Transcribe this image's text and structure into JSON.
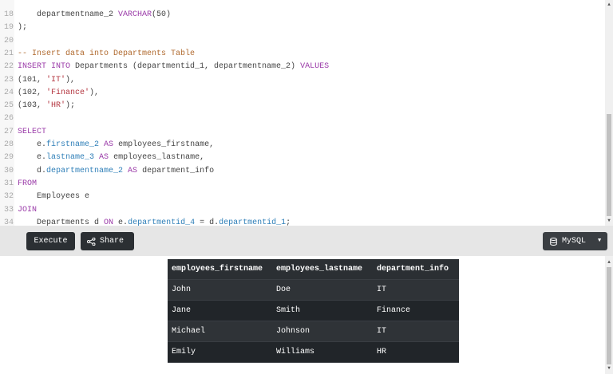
{
  "editor": {
    "lines": [
      {
        "n": "18",
        "tokens": [
          {
            "c": "tx",
            "t": "    departmentname_2 "
          },
          {
            "c": "kw",
            "t": "VARCHAR"
          },
          {
            "c": "tx",
            "t": "(50)"
          }
        ]
      },
      {
        "n": "19",
        "tokens": [
          {
            "c": "tx",
            "t": ");"
          }
        ]
      },
      {
        "n": "20",
        "tokens": []
      },
      {
        "n": "21",
        "tokens": [
          {
            "c": "cm",
            "t": "-- Insert data into Departments Table"
          }
        ]
      },
      {
        "n": "22",
        "tokens": [
          {
            "c": "kw",
            "t": "INSERT INTO"
          },
          {
            "c": "tx",
            "t": " Departments (departmentid_1, departmentname_2) "
          },
          {
            "c": "kw",
            "t": "VALUES"
          }
        ]
      },
      {
        "n": "23",
        "tokens": [
          {
            "c": "tx",
            "t": "(101, "
          },
          {
            "c": "str",
            "t": "'IT'"
          },
          {
            "c": "tx",
            "t": "),"
          }
        ]
      },
      {
        "n": "24",
        "tokens": [
          {
            "c": "tx",
            "t": "(102, "
          },
          {
            "c": "str",
            "t": "'Finance'"
          },
          {
            "c": "tx",
            "t": "),"
          }
        ]
      },
      {
        "n": "25",
        "tokens": [
          {
            "c": "tx",
            "t": "(103, "
          },
          {
            "c": "str",
            "t": "'HR'"
          },
          {
            "c": "tx",
            "t": ");"
          }
        ]
      },
      {
        "n": "26",
        "tokens": []
      },
      {
        "n": "27",
        "tokens": [
          {
            "c": "kw",
            "t": "SELECT"
          }
        ]
      },
      {
        "n": "28",
        "tokens": [
          {
            "c": "tx",
            "t": "    e."
          },
          {
            "c": "fn",
            "t": "firstname_2"
          },
          {
            "c": "tx",
            "t": " "
          },
          {
            "c": "kw",
            "t": "AS"
          },
          {
            "c": "tx",
            "t": " employees_firstname,"
          }
        ]
      },
      {
        "n": "29",
        "tokens": [
          {
            "c": "tx",
            "t": "    e."
          },
          {
            "c": "fn",
            "t": "lastname_3"
          },
          {
            "c": "tx",
            "t": " "
          },
          {
            "c": "kw",
            "t": "AS"
          },
          {
            "c": "tx",
            "t": " employees_lastname,"
          }
        ]
      },
      {
        "n": "30",
        "tokens": [
          {
            "c": "tx",
            "t": "    d."
          },
          {
            "c": "fn",
            "t": "departmentname_2"
          },
          {
            "c": "tx",
            "t": " "
          },
          {
            "c": "kw",
            "t": "AS"
          },
          {
            "c": "tx",
            "t": " department_info"
          }
        ]
      },
      {
        "n": "31",
        "tokens": [
          {
            "c": "kw",
            "t": "FROM"
          }
        ]
      },
      {
        "n": "32",
        "tokens": [
          {
            "c": "tx",
            "t": "    Employees e"
          }
        ]
      },
      {
        "n": "33",
        "tokens": [
          {
            "c": "kw",
            "t": "JOIN"
          }
        ]
      },
      {
        "n": "34",
        "tokens": [
          {
            "c": "tx",
            "t": "    Departments d "
          },
          {
            "c": "kw",
            "t": "ON"
          },
          {
            "c": "tx",
            "t": " e."
          },
          {
            "c": "fn",
            "t": "departmentid_4"
          },
          {
            "c": "tx",
            "t": " = d."
          },
          {
            "c": "fn",
            "t": "departmentid_1"
          },
          {
            "c": "tx",
            "t": ";"
          }
        ]
      }
    ]
  },
  "toolbar": {
    "execute_label": "Execute",
    "share_label": "Share",
    "db_label": "MySQL",
    "share_icon": "share-icon",
    "db_icon": "database-icon"
  },
  "results": {
    "headers": [
      "employees_firstname",
      "employees_lastname",
      "department_info"
    ],
    "rows": [
      [
        "John",
        "Doe",
        "IT"
      ],
      [
        "Jane",
        "Smith",
        "Finance"
      ],
      [
        "Michael",
        "Johnson",
        "IT"
      ],
      [
        "Emily",
        "Williams",
        "HR"
      ]
    ]
  },
  "colors": {
    "keyword": "#9a3aa8",
    "field": "#2f7fb8",
    "string": "#b3343e",
    "comment": "#b06a2f",
    "button_bg": "#2b2f33",
    "toolbar_bg": "#e6e6e6"
  }
}
